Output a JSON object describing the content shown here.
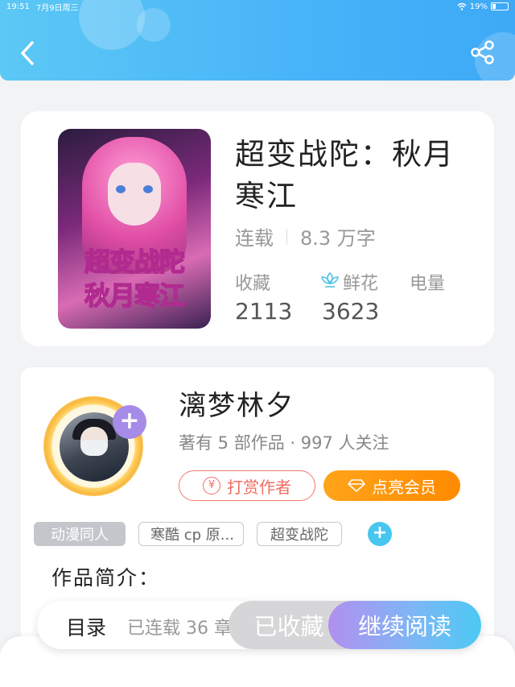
{
  "status_bar": {
    "time": "19:51",
    "date": "7月9日周三",
    "battery": "19%"
  },
  "header": {
    "back_icon": "chevron-left-icon",
    "share_icon": "share-icon",
    "color": "#47b3f8"
  },
  "book": {
    "cover_title_line1": "超变战陀",
    "cover_title_line2": "秋月寒江",
    "title": "超变战陀：秋月寒江",
    "status": "连载",
    "word_count": "8.3 万字",
    "stats": {
      "favorites_label": "收藏",
      "favorites_value": "2113",
      "flowers_label": "鲜花",
      "flowers_value": "3623",
      "power_label": "电量"
    }
  },
  "author": {
    "name": "漓梦林夕",
    "stats": "著有 5 部作品 · 997 人关注",
    "tip_button": "打赏作者",
    "vip_button": "点亮会员"
  },
  "tags": [
    "动漫同人",
    "寒酷 cp 原...",
    "超变战陀"
  ],
  "intro_label": "作品简介：",
  "bottom_bar": {
    "toc": "目录",
    "chapters": "已连载 36 章",
    "collected": "已收藏",
    "continue": "继续阅读"
  },
  "colors": {
    "accent_blue": "#47c6f0",
    "tip_red": "#ef6d63",
    "vip_orange": "#ff8a00"
  }
}
